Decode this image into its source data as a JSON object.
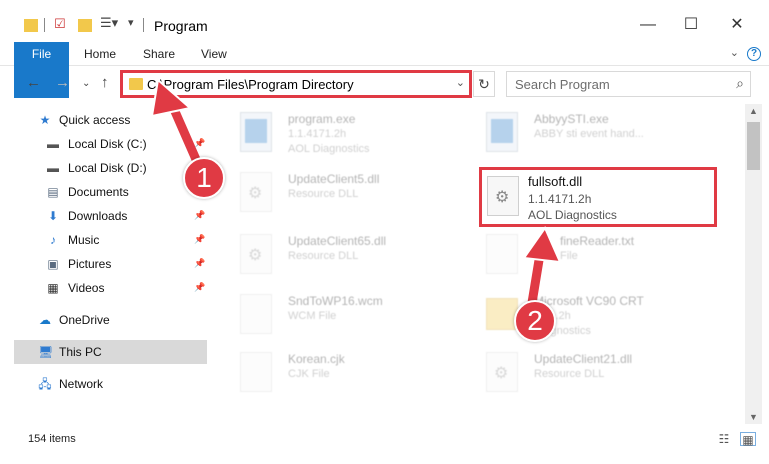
{
  "window": {
    "title": "Program",
    "minimize": "—",
    "maximize": "☐",
    "close": "✕"
  },
  "ribbon": {
    "tabs": [
      "File",
      "Home",
      "Share",
      "View"
    ],
    "help": "?"
  },
  "address": {
    "path": "C:\\Program Files\\Program Directory",
    "search_placeholder": "Search Program"
  },
  "sidebar": {
    "items": [
      {
        "label": "Quick access",
        "icon": "star-icon",
        "pinned": false
      },
      {
        "label": "Local Disk (C:)",
        "icon": "drive-icon",
        "pinned": true
      },
      {
        "label": "Local Disk (D:)",
        "icon": "drive-icon",
        "pinned": false
      },
      {
        "label": "Documents",
        "icon": "documents-icon",
        "pinned": true
      },
      {
        "label": "Downloads",
        "icon": "download-icon",
        "pinned": true
      },
      {
        "label": "Music",
        "icon": "music-icon",
        "pinned": true
      },
      {
        "label": "Pictures",
        "icon": "pictures-icon",
        "pinned": true
      },
      {
        "label": "Videos",
        "icon": "videos-icon",
        "pinned": true
      },
      {
        "label": "OneDrive",
        "icon": "cloud-icon",
        "pinned": false
      },
      {
        "label": "This PC",
        "icon": "computer-icon",
        "pinned": false,
        "selected": true
      },
      {
        "label": "Network",
        "icon": "network-icon",
        "pinned": false
      }
    ]
  },
  "files": {
    "left": [
      {
        "name": "program.exe",
        "line2": "1.1.4171.2h",
        "line3": "AOL Diagnostics",
        "icon": "app-icon"
      },
      {
        "name": "UpdateClient5.dll",
        "line2": "Resource DLL",
        "line3": "",
        "icon": "gear-file-icon"
      },
      {
        "name": "UpdateClient65.dll",
        "line2": "Resource DLL",
        "line3": "",
        "icon": "gear-file-icon"
      },
      {
        "name": "SndToWP16.wcm",
        "line2": "WCM File",
        "line3": "",
        "icon": "file-icon"
      },
      {
        "name": "Korean.cjk",
        "line2": "CJK File",
        "line3": "",
        "icon": "file-icon"
      }
    ],
    "right": [
      {
        "name": "AbbyySTI.exe",
        "line2": "ABBY sti event hand...",
        "line3": "",
        "icon": "app-icon"
      },
      {
        "name": "fineReader.txt",
        "line2": "File",
        "line3": "",
        "icon": "file-icon"
      },
      {
        "name": "Microsoft VC90 CRT",
        "line2": "...71.2h",
        "line3": "Diagnostics",
        "icon": "folder-icon"
      },
      {
        "name": "UpdateClient21.dll",
        "line2": "Resource DLL",
        "line3": "",
        "icon": "gear-file-icon"
      }
    ],
    "highlighted": {
      "name": "fullsoft.dll",
      "line2": "1.1.4171.2h",
      "line3": "AOL Diagnostics",
      "icon": "gear-file-icon"
    }
  },
  "status": {
    "count": "154 items"
  },
  "annotations": {
    "step1": "1",
    "step2": "2",
    "color": "#e03a44"
  }
}
